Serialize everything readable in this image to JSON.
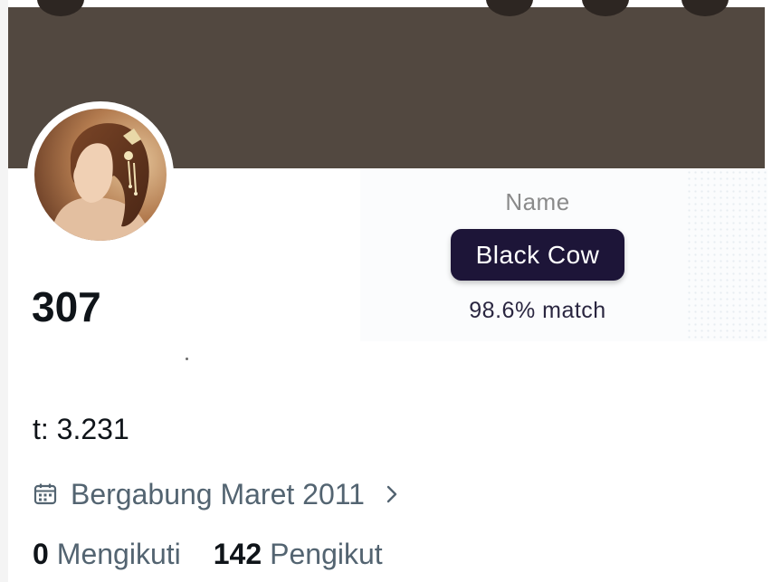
{
  "profile": {
    "count_value": "307",
    "stat_line": "t: 3.231",
    "joined_text": "Bergabung Maret 2011",
    "following": {
      "count": "0",
      "label": "Mengikuti"
    },
    "followers": {
      "count": "142",
      "label": "Pengikut"
    }
  },
  "name_card": {
    "label": "Name",
    "value": "Black Cow",
    "match": "98.6% match"
  },
  "icons": {
    "joined": "calendar-icon",
    "more": "chevron-right-icon"
  },
  "colors": {
    "banner": "#524840",
    "chip": "#1d1538",
    "secondary_text": "#536471",
    "primary_text": "#0f1419"
  }
}
